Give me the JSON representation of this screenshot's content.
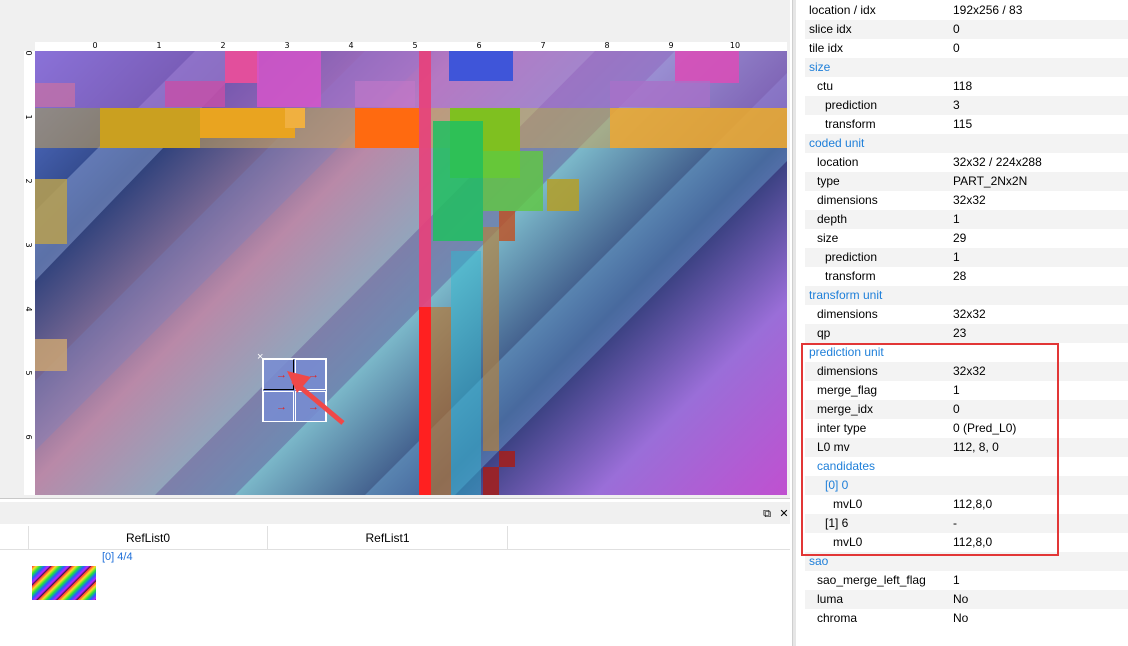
{
  "ruler": {
    "x_ticks": [
      "0",
      "1",
      "2",
      "3",
      "4",
      "5",
      "6",
      "7",
      "8",
      "9",
      "10"
    ],
    "y_ticks": [
      "0",
      "1",
      "2",
      "3",
      "4",
      "5",
      "6"
    ]
  },
  "selected_block": {
    "marker": "×",
    "arrow": "→"
  },
  "bottom_panel": {
    "float_icon": "⧉",
    "close_icon": "✕",
    "columns": [
      "RefList0",
      "RefList1"
    ],
    "entry": "[0]  4/4"
  },
  "properties": [
    {
      "key": "location / idx",
      "value": "192x256 / 83",
      "indent": 0,
      "section": false
    },
    {
      "key": "slice idx",
      "value": "0",
      "indent": 0,
      "section": false
    },
    {
      "key": "tile idx",
      "value": "0",
      "indent": 0,
      "section": false
    },
    {
      "key": "size",
      "value": "",
      "indent": 0,
      "section": true
    },
    {
      "key": "ctu",
      "value": "118",
      "indent": 1,
      "section": false
    },
    {
      "key": "prediction",
      "value": "3",
      "indent": 2,
      "section": false
    },
    {
      "key": "transform",
      "value": "115",
      "indent": 2,
      "section": false
    },
    {
      "key": "coded unit",
      "value": "",
      "indent": 0,
      "section": true
    },
    {
      "key": "location",
      "value": "32x32 / 224x288",
      "indent": 1,
      "section": false
    },
    {
      "key": "type",
      "value": "PART_2Nx2N",
      "indent": 1,
      "section": false
    },
    {
      "key": "dimensions",
      "value": "32x32",
      "indent": 1,
      "section": false
    },
    {
      "key": "depth",
      "value": "1",
      "indent": 1,
      "section": false
    },
    {
      "key": "size",
      "value": "29",
      "indent": 1,
      "section": false
    },
    {
      "key": "prediction",
      "value": "1",
      "indent": 2,
      "section": false
    },
    {
      "key": "transform",
      "value": "28",
      "indent": 2,
      "section": false
    },
    {
      "key": "transform unit",
      "value": "",
      "indent": 0,
      "section": true
    },
    {
      "key": "dimensions",
      "value": "32x32",
      "indent": 1,
      "section": false
    },
    {
      "key": "qp",
      "value": "23",
      "indent": 1,
      "section": false
    },
    {
      "key": "prediction unit",
      "value": "",
      "indent": 0,
      "section": true
    },
    {
      "key": "dimensions",
      "value": "32x32",
      "indent": 1,
      "section": false
    },
    {
      "key": "merge_flag",
      "value": "1",
      "indent": 1,
      "section": false
    },
    {
      "key": "merge_idx",
      "value": "0",
      "indent": 1,
      "section": false
    },
    {
      "key": "inter type",
      "value": "0 (Pred_L0)",
      "indent": 1,
      "section": false
    },
    {
      "key": "L0 mv",
      "value": "112, 8, 0",
      "indent": 1,
      "section": false
    },
    {
      "key": "candidates",
      "value": "",
      "indent": 1,
      "section": true
    },
    {
      "key": "[0] 0",
      "value": "",
      "indent": 2,
      "section": true
    },
    {
      "key": "mvL0",
      "value": "112,8,0",
      "indent": 3,
      "section": false
    },
    {
      "key": "[1] 6",
      "value": "-",
      "indent": 2,
      "section": false
    },
    {
      "key": "mvL0",
      "value": "112,8,0",
      "indent": 3,
      "section": false
    },
    {
      "key": "sao",
      "value": "",
      "indent": 0,
      "section": true
    },
    {
      "key": "sao_merge_left_flag",
      "value": "1",
      "indent": 1,
      "section": false
    },
    {
      "key": "luma",
      "value": "No",
      "indent": 1,
      "section": false
    },
    {
      "key": "chroma",
      "value": "No",
      "indent": 1,
      "section": false
    }
  ],
  "colors": {
    "section": "#1e7fd9",
    "highlight": "#e23636",
    "annotation_arrow": "#f04848"
  }
}
